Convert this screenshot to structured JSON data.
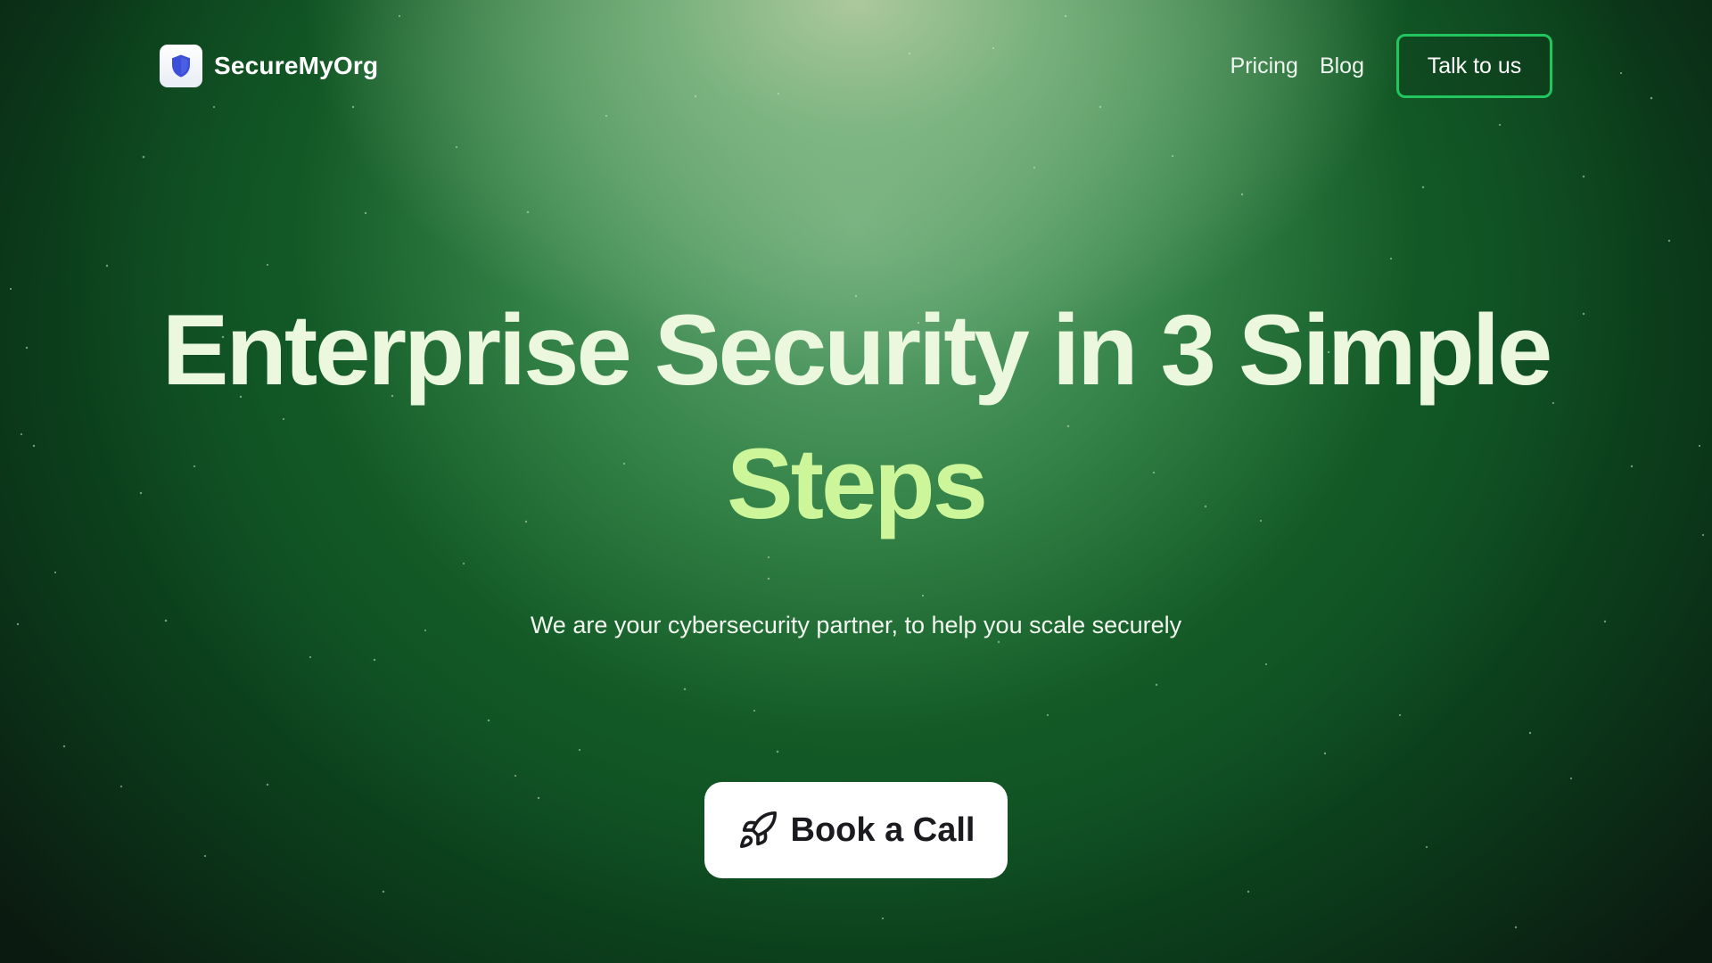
{
  "brand": {
    "name": "SecureMyOrg",
    "logo_icon": "shield-icon",
    "logo_color": "#3b4fd8"
  },
  "nav": {
    "links": [
      {
        "label": "Pricing"
      },
      {
        "label": "Blog"
      }
    ],
    "cta_label": "Talk to us",
    "cta_border_color": "#22c55e"
  },
  "hero": {
    "headline_line1": "Enterprise Security in 3 Simple",
    "headline_line2": "Steps",
    "subtitle": "We are your cybersecurity partner, to help you scale securely",
    "cta_label": "Book a Call",
    "cta_icon": "rocket-icon"
  },
  "colors": {
    "background_dark": "#0b3a1a",
    "headline_light": "#ecf8de",
    "headline_accent": "#cdf59a"
  }
}
